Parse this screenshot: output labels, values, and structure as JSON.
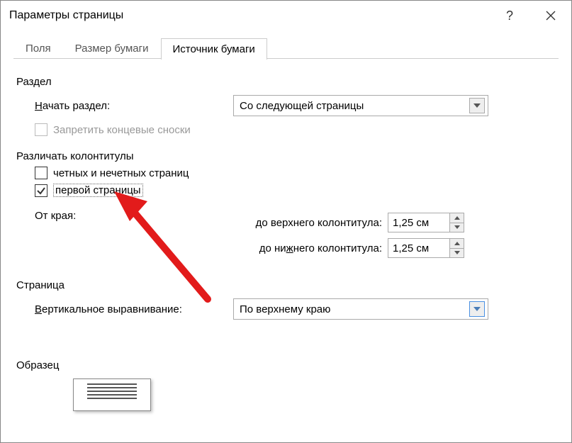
{
  "titlebar": {
    "title": "Параметры страницы"
  },
  "tabs": {
    "t0": "Поля",
    "t1": "Размер бумаги",
    "t2": "Источник бумаги"
  },
  "section": {
    "title": "Раздел",
    "start_label_pre": "Н",
    "start_label_post": "ачать раздел:",
    "start_value": "Со следующей страницы",
    "suppress_endnotes": "Запретить концевые сноски"
  },
  "headers": {
    "title": "Различать колонтитулы",
    "odd_even": "четных и нечетных страниц",
    "first_page": "первой страницы",
    "from_edge": "От края:",
    "header_label": "до верхнего колонтитула:",
    "footer_label_pre": "до ни",
    "footer_label_mid": "ж",
    "footer_label_post": "него колонтитула:",
    "header_value": "1,25 см",
    "footer_value": "1,25 см"
  },
  "page": {
    "title": "Страница",
    "valign_label_pre": "В",
    "valign_label_post": "ертикальное выравнивание:",
    "valign_value": "По верхнему краю"
  },
  "sample": {
    "title": "Образец"
  }
}
